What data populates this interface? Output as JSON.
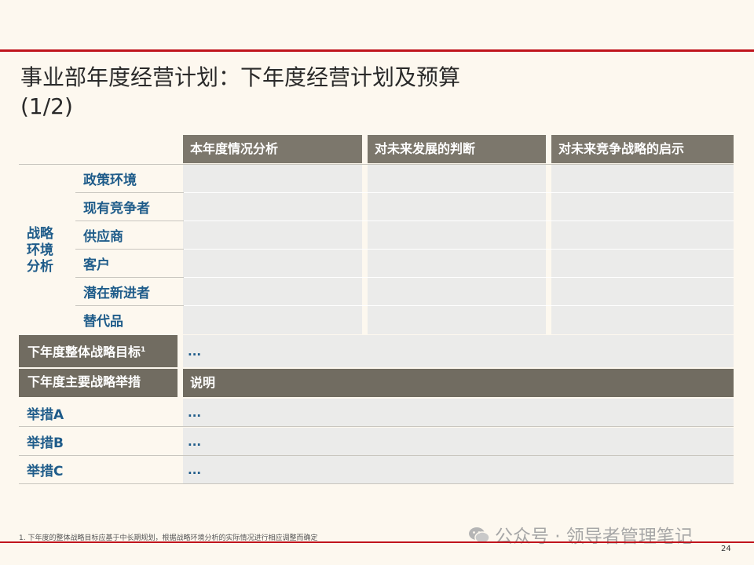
{
  "title": {
    "line1": "事业部年度经营计划：下年度经营计划及预算",
    "line2": "(1/2)"
  },
  "table": {
    "headers": [
      "本年度情况分析",
      "对未来发展的判断",
      "对未来竞争战略的启示"
    ],
    "side_label": "战略环境分析",
    "rows": [
      "政策环境",
      "现有竞争者",
      "供应商",
      "客户",
      "潜在新进者",
      "替代品"
    ],
    "target_label": "下年度整体战略目标",
    "target_sup": "1",
    "target_value": "...",
    "measures_label": "下年度主要战略举措",
    "measures_header": "说明",
    "measures": [
      {
        "label": "举措A",
        "value": "..."
      },
      {
        "label": "举措B",
        "value": "..."
      },
      {
        "label": "举措C",
        "value": "..."
      }
    ]
  },
  "footnote": "1. 下年度的整体战略目标应基于中长期规划，根据战略环境分析的实际情况进行相应调整而确定",
  "watermark": "公众号 · 领导者管理笔记",
  "page_number": "24",
  "colors": {
    "accent_red": "#c0141c",
    "header_grey": "#7c776c",
    "label_blue": "#1f5c8a",
    "cell_grey": "#ebebea"
  }
}
